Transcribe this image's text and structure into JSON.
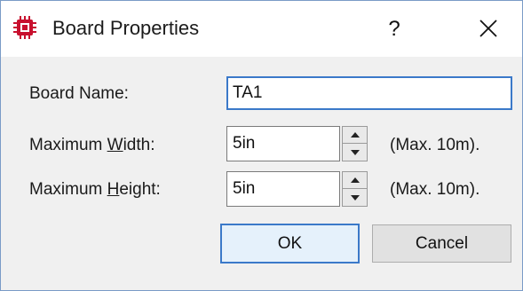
{
  "window": {
    "title": "Board Properties",
    "help_label": "?",
    "icons": {
      "app": "chip-icon",
      "close": "close-icon"
    }
  },
  "form": {
    "board_name": {
      "label": "Board Name:",
      "value": "TA1"
    },
    "max_width": {
      "label_pre": "Maximum ",
      "label_access": "W",
      "label_post": "idth:",
      "value": "5in",
      "suffix": "(Max. 10m)."
    },
    "max_height": {
      "label_pre": "Maximum ",
      "label_access": "H",
      "label_post": "eight:",
      "value": "5in",
      "suffix": "(Max. 10m)."
    }
  },
  "buttons": {
    "ok": "OK",
    "cancel": "Cancel"
  },
  "colors": {
    "accent": "#3b79c9",
    "icon_red": "#c8102e",
    "client_bg": "#f0f0f0"
  }
}
